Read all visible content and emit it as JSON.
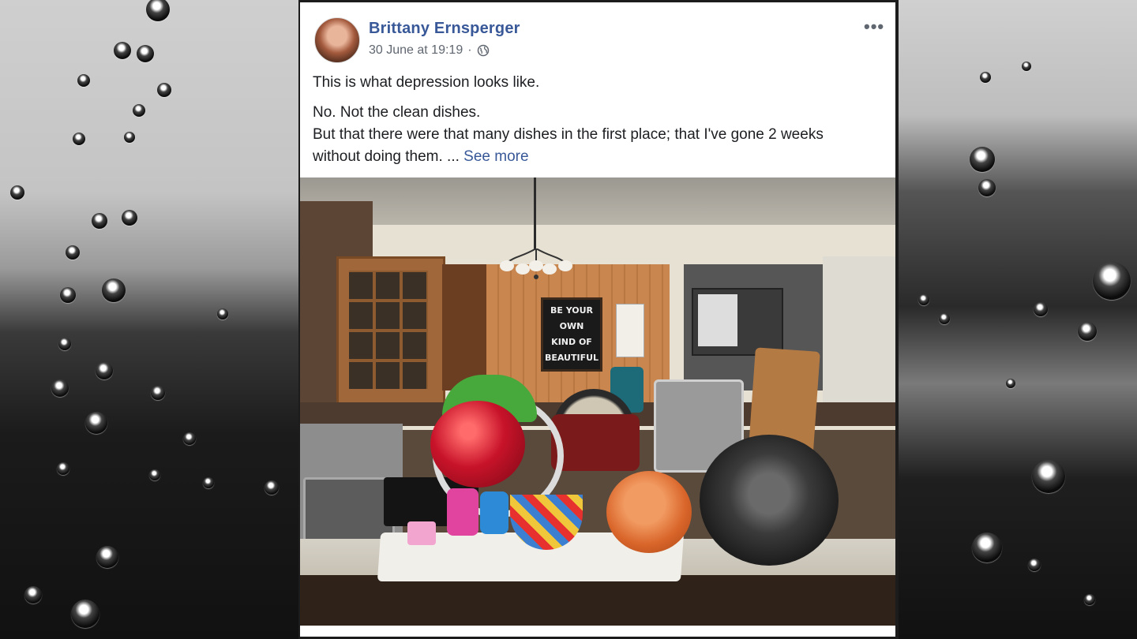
{
  "post": {
    "author": "Brittany Ernsperger",
    "timestamp": "30 June at 19:19",
    "separator": "·",
    "privacy_icon": "globe-icon",
    "more_icon": "more-options-icon",
    "more_label": "•••",
    "text_line1": "This is what depression looks like.",
    "text_line2": "No. Not the clean dishes.",
    "text_line3": "But that there were that many dishes in the first place; that I've gone 2 weeks without doing them. ...",
    "see_more_label": "See more",
    "photo": {
      "sign_line1": "BE YOUR",
      "sign_line2": "OWN",
      "sign_line3": "KIND OF",
      "sign_line4": "BEAUTIFUL"
    }
  },
  "colors": {
    "link": "#385898",
    "meta_text": "#606770",
    "body_text": "#1c1e21",
    "card_bg": "#ffffff"
  }
}
